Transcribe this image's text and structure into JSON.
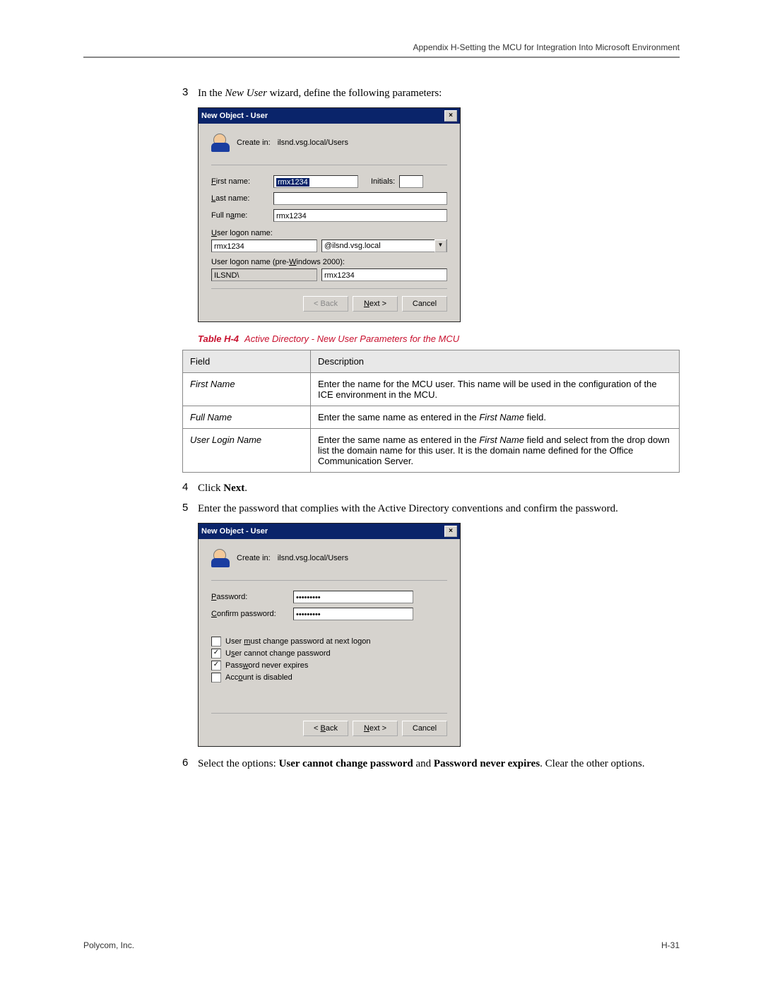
{
  "header": "Appendix H-Setting the MCU for Integration Into Microsoft Environment",
  "steps": {
    "s3": {
      "num": "3",
      "pre": "In the ",
      "ital": "New User",
      "post": " wizard, define the following parameters:"
    },
    "s4": {
      "num": "4",
      "pre": "Click ",
      "bold": "Next",
      "post": "."
    },
    "s5": {
      "num": "5",
      "text": "Enter the password that complies with the Active Directory conventions and confirm the password."
    },
    "s6": {
      "num": "6",
      "pre": "Select the options: ",
      "b1": "User cannot change password",
      "mid": " and ",
      "b2": "Password never expires",
      "post": ". Clear the other options."
    }
  },
  "dialog1": {
    "title": "New Object - User",
    "create_in_lbl": "Create in:",
    "create_in_val": "ilsnd.vsg.local/Users",
    "first_name_lbl": "First name:",
    "first_name_val": "rmx1234",
    "initials_lbl": "Initials:",
    "last_name_lbl": "Last name:",
    "full_name_lbl": "Full name:",
    "full_name_val": "rmx1234",
    "logon_lbl": "User logon name:",
    "logon_val": "rmx1234",
    "logon_domain": "@ilsnd.vsg.local",
    "logon_pre_lbl": "User logon name (pre-Windows 2000):",
    "pre_domain": "ILSND\\",
    "pre_user": "rmx1234",
    "back": "< Back",
    "next": "Next >",
    "cancel": "Cancel"
  },
  "dialog2": {
    "title": "New Object - User",
    "create_in_lbl": "Create in:",
    "create_in_val": "ilsnd.vsg.local/Users",
    "password_lbl": "Password:",
    "password_val": "•••••••••",
    "confirm_lbl": "Confirm password:",
    "confirm_val": "•••••••••",
    "opt_must": "User must change password at next logon",
    "opt_cannot": "User cannot change password",
    "opt_never": "Password never expires",
    "opt_disabled": "Account is disabled",
    "back": "< Back",
    "next": "Next >",
    "cancel": "Cancel"
  },
  "table": {
    "caption_num": "Table H-4",
    "caption_txt": "Active Directory - New User Parameters for the MCU",
    "col_field": "Field",
    "col_desc": "Description",
    "rows": [
      {
        "field": "First Name",
        "desc_pre": "Enter the name for the MCU user. This name will be used in the configuration of the ICE environment in the MCU."
      },
      {
        "field": "Full Name",
        "desc_pre": "Enter the same name as entered in the ",
        "ital": "First Name",
        "desc_post": " field."
      },
      {
        "field": "User Login Name",
        "desc_pre": "Enter the same name as entered in the ",
        "ital": "First Name",
        "desc_post": " field and select from the drop down list the domain name for this user. It is the domain name defined for the Office Communication Server."
      }
    ]
  },
  "footer": {
    "left": "Polycom, Inc.",
    "right": "H-31"
  },
  "check": "✓"
}
